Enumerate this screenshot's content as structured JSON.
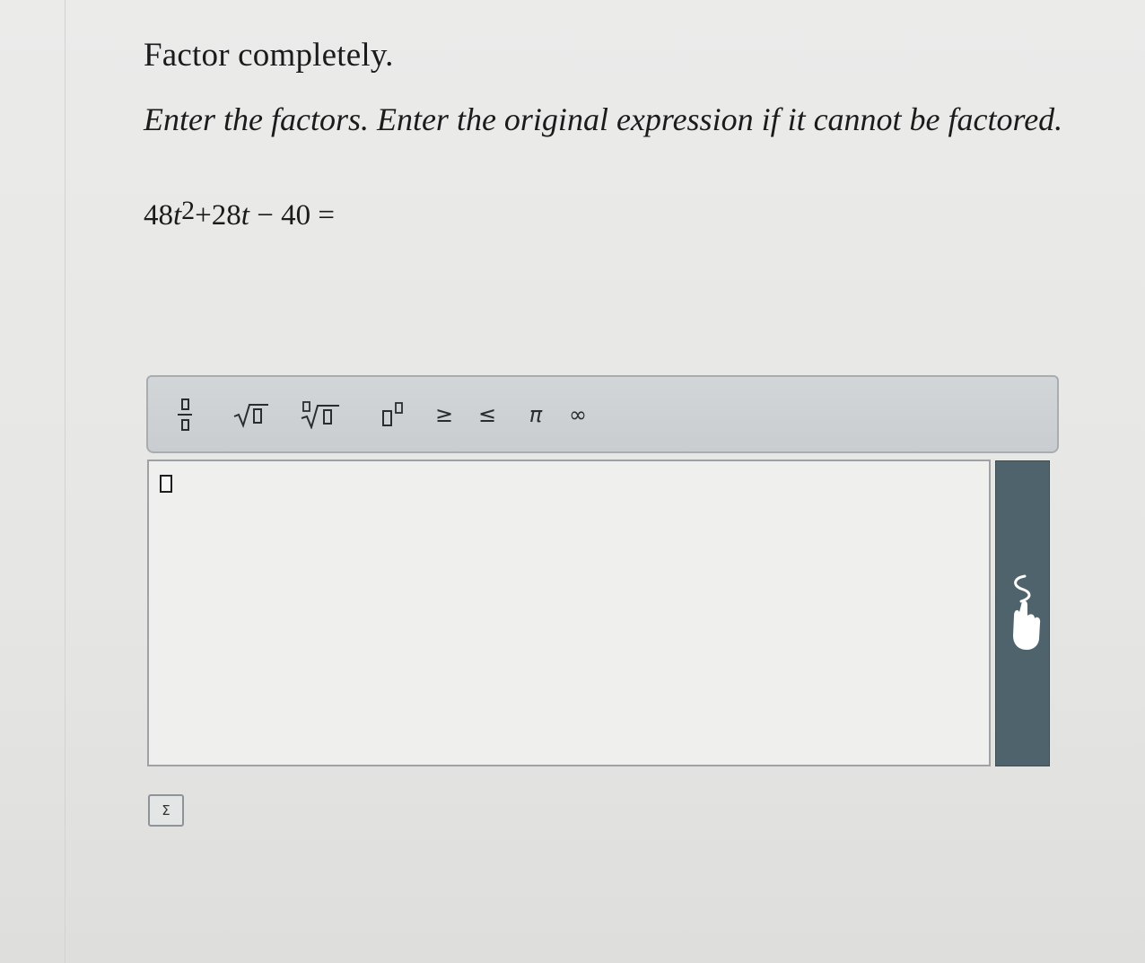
{
  "question": {
    "title": "Factor completely.",
    "instructions": "Enter the factors. Enter the original expression if it cannot be factored.",
    "expression": {
      "coef1": "48",
      "var1": "t",
      "exp1": "2",
      "term2": "+28",
      "var2": "t",
      "rest": " − 40 ="
    }
  },
  "toolbar": {
    "buttons": [
      {
        "name": "fraction",
        "icon": "fraction-icon"
      },
      {
        "name": "square-root",
        "icon": "square-root-icon"
      },
      {
        "name": "nth-root",
        "icon": "nth-root-icon"
      },
      {
        "name": "exponent",
        "icon": "superscript-icon"
      },
      {
        "name": "greater-equal",
        "label": "≥"
      },
      {
        "name": "less-equal",
        "label": "≤"
      },
      {
        "name": "pi",
        "label": "π"
      },
      {
        "name": "infinity",
        "label": "∞"
      }
    ],
    "colors": {
      "background": "#ccd0d2",
      "icon": "#2a2d30"
    }
  },
  "answer": {
    "value": "",
    "draw_panel_icon": "hand-draw-icon",
    "draw_panel_color": "#4e636c"
  },
  "sigma_button": {
    "label": "Σ"
  }
}
